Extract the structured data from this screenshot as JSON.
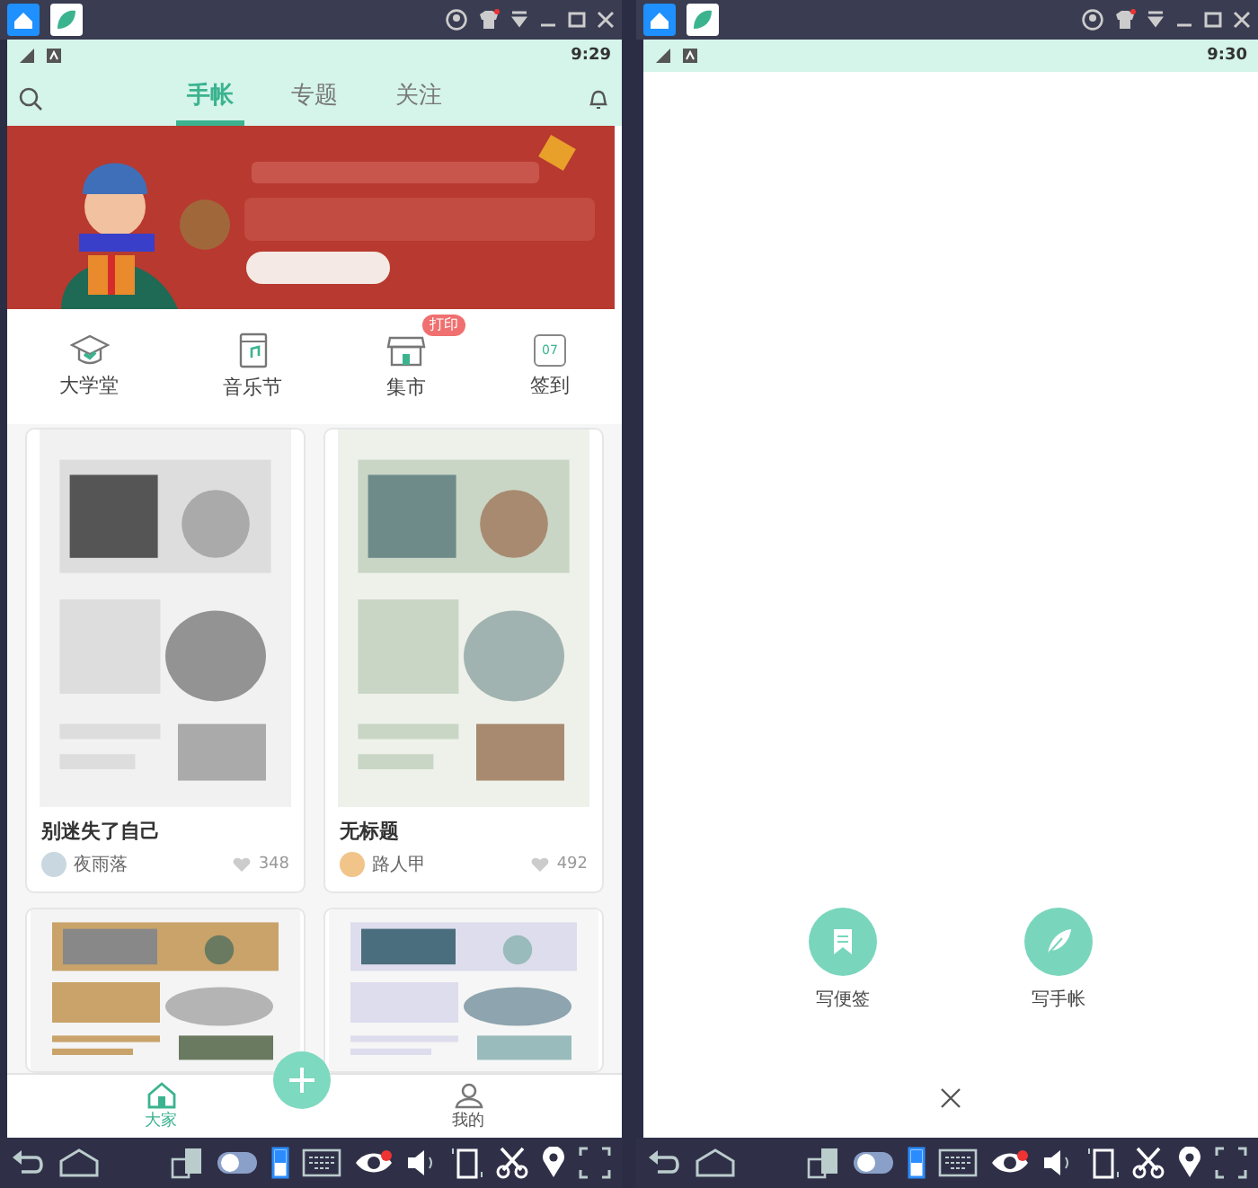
{
  "panes": [
    {
      "kind": "feed",
      "status_time": "9:29",
      "header": {
        "tabs": [
          {
            "label": "手帐",
            "selected": true
          },
          {
            "label": "专题",
            "selected": false
          },
          {
            "label": "关注",
            "selected": false
          }
        ]
      },
      "banner": {
        "kind": "picture"
      },
      "shortcuts": [
        {
          "label": "大学堂"
        },
        {
          "label": "音乐节"
        },
        {
          "label": "集市",
          "badge": "打印"
        },
        {
          "label": "签到",
          "icon_text": "07"
        }
      ],
      "posts": [
        {
          "kind": "full",
          "title": "别迷失了自己",
          "author": "夜雨落",
          "likes": "348"
        },
        {
          "kind": "full",
          "title": "无标题",
          "author": "路人甲",
          "likes": "492"
        },
        {
          "kind": "picture"
        },
        {
          "kind": "picture"
        }
      ],
      "nav": [
        {
          "label": "大家",
          "selected": true
        },
        {
          "label": "我的",
          "selected": false
        }
      ]
    },
    {
      "kind": "compose",
      "status_time": "9:30",
      "actions": [
        {
          "label": "写便签"
        },
        {
          "label": "写手帐"
        }
      ]
    }
  ]
}
